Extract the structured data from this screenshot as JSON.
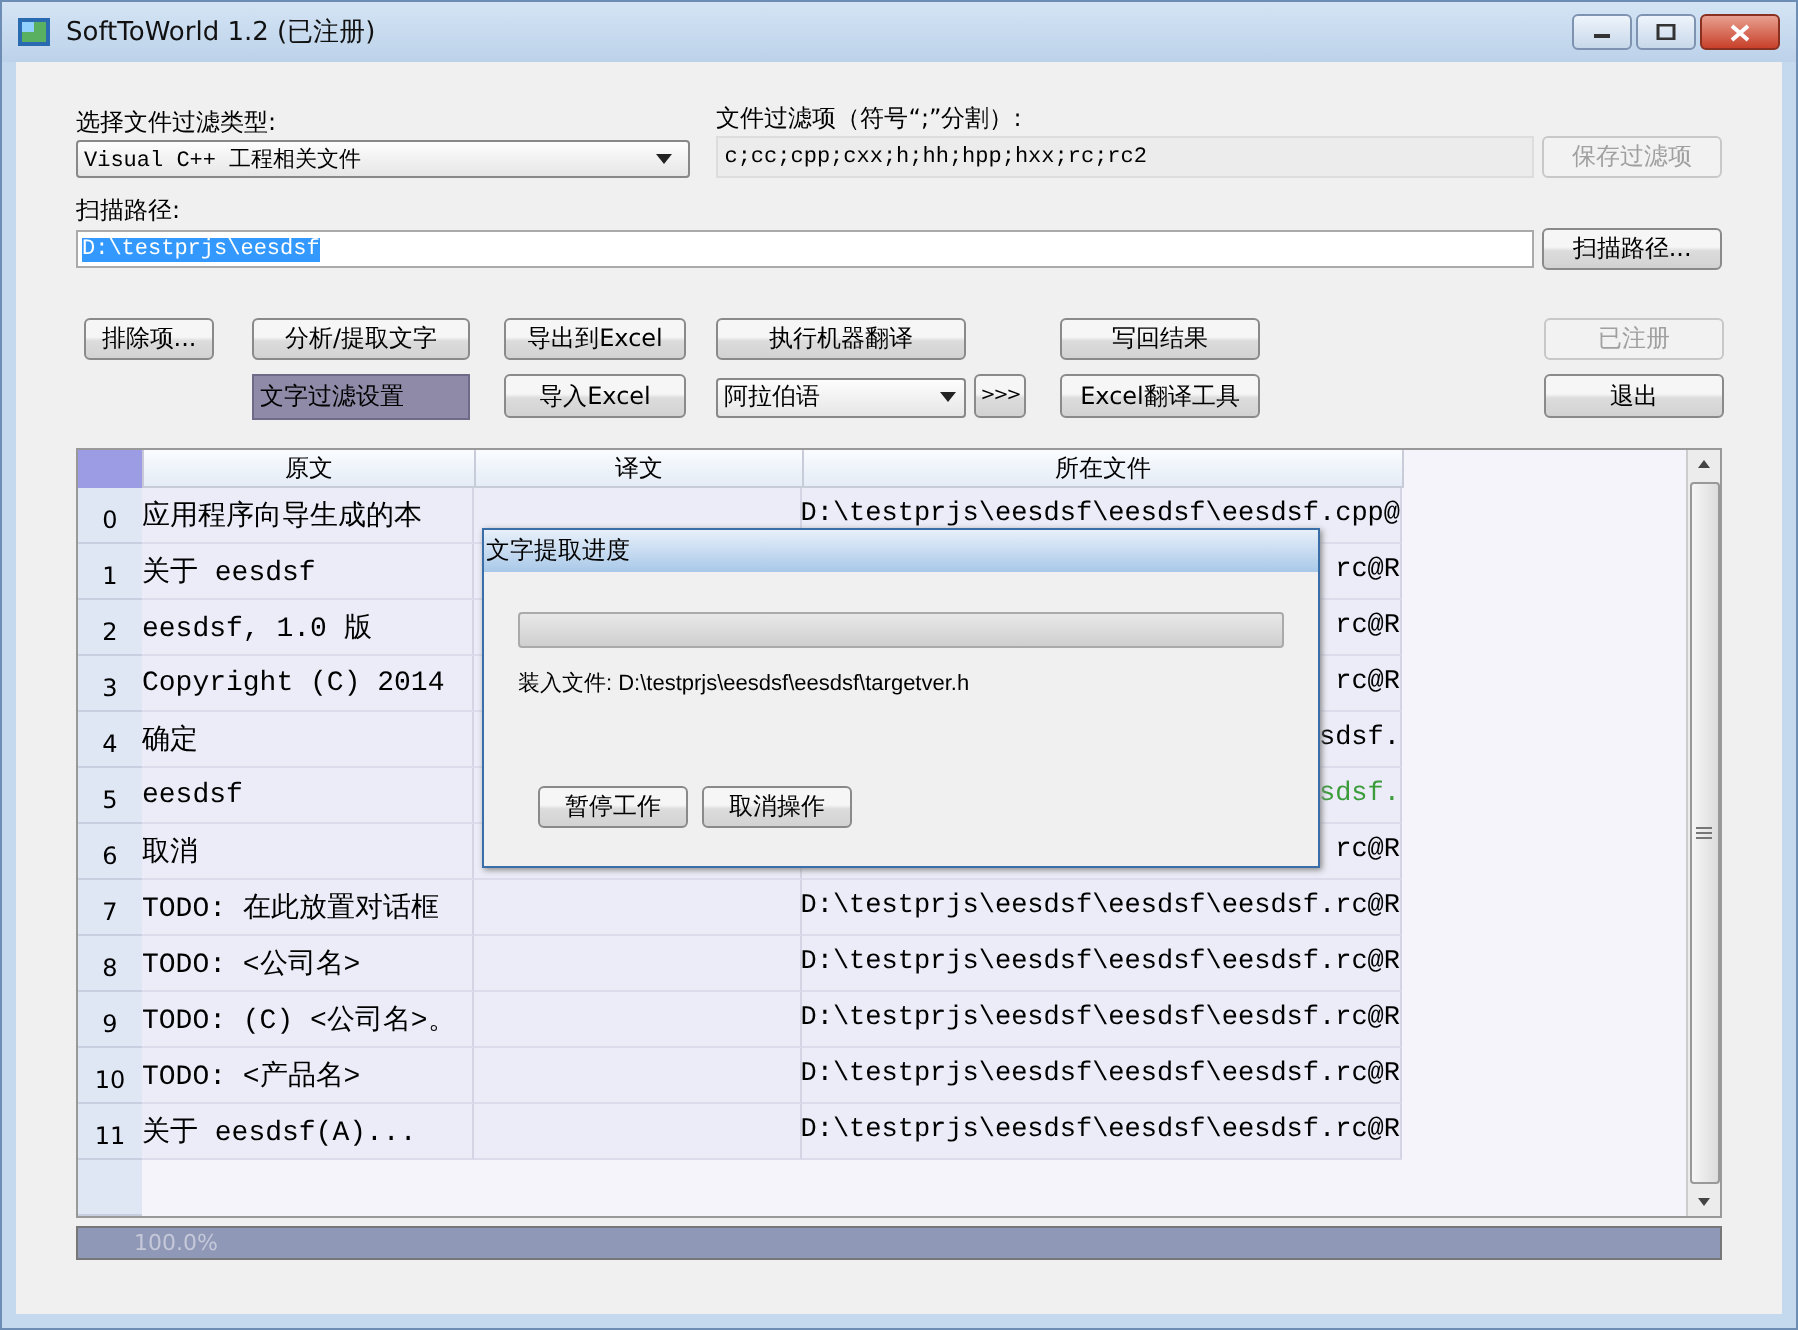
{
  "window": {
    "title": "SoftToWorld 1.2 (已注册)"
  },
  "filter_type": {
    "label": "选择文件过滤类型:",
    "value": "Visual C++ 工程相关文件"
  },
  "filter_items": {
    "label": "文件过滤项（符号“;”分割）:",
    "value": "c;cc;cpp;cxx;h;hh;hpp;hxx;rc;rc2"
  },
  "save_filter_button": {
    "label": "保存过滤项",
    "disabled": true
  },
  "scan_path": {
    "label": "扫描路径:",
    "value": "D:\\testprjs\\eesdsf",
    "selected": true
  },
  "scan_button": {
    "label": "扫描路径...",
    "disabled": false
  },
  "actions_row_1": [
    {
      "kind": "button",
      "label": "排除项...",
      "disabled": false
    },
    {
      "kind": "button",
      "label": "分析/提取文字",
      "disabled": false
    },
    {
      "kind": "button",
      "label": "导出到Excel",
      "disabled": false
    },
    {
      "kind": "button",
      "label": "执行机器翻译",
      "disabled": false
    },
    {
      "kind": "button",
      "label": "写回结果",
      "disabled": false
    },
    {
      "kind": "button",
      "label": "已注册",
      "disabled": true
    }
  ],
  "actions_row_2": [
    {
      "kind": "label",
      "label": "文字过滤设置"
    },
    {
      "kind": "button",
      "label": "导入Excel",
      "disabled": false
    },
    {
      "kind": "dropdown",
      "label": "阿拉伯语"
    },
    {
      "kind": "button",
      "label": ">>>",
      "disabled": false
    },
    {
      "kind": "button",
      "label": "Excel翻译工具",
      "disabled": false
    },
    {
      "kind": "button",
      "label": "退出",
      "disabled": false
    }
  ],
  "table": {
    "columns": [
      "原文",
      "译文",
      "所在文件"
    ],
    "rows": [
      {
        "index": "0",
        "source": "应用程序向导生成的本",
        "file": "D:\\testprjs\\eesdsf\\eesdsf\\eesdsf.cpp@",
        "color": "#000000"
      },
      {
        "index": "1",
        "source": "关于 eesdsf",
        "file": "rc@R",
        "color": "#000000"
      },
      {
        "index": "2",
        "source": "eesdsf, 1.0 版",
        "file": "rc@R",
        "color": "#000000"
      },
      {
        "index": "3",
        "source": "Copyright (C) 2014",
        "file": "rc@R",
        "color": "#000000"
      },
      {
        "index": "4",
        "source": "确定",
        "file": "sdsf.",
        "color": "#000000"
      },
      {
        "index": "5",
        "source": "eesdsf",
        "file": "sdsf.",
        "color": "#3c9c3c"
      },
      {
        "index": "6",
        "source": "取消",
        "file": "rc@R",
        "color": "#000000"
      },
      {
        "index": "7",
        "source": "TODO: 在此放置对话框",
        "file": "D:\\testprjs\\eesdsf\\eesdsf\\eesdsf.rc@R",
        "color": "#000000"
      },
      {
        "index": "8",
        "source": "TODO: <公司名>",
        "file": "D:\\testprjs\\eesdsf\\eesdsf\\eesdsf.rc@R",
        "color": "#000000"
      },
      {
        "index": "9",
        "source": "TODO: (C) <公司名>。",
        "file": "D:\\testprjs\\eesdsf\\eesdsf\\eesdsf.rc@R",
        "color": "#000000"
      },
      {
        "index": "10",
        "source": "TODO: <产品名>",
        "file": "D:\\testprjs\\eesdsf\\eesdsf\\eesdsf.rc@R",
        "color": "#000000"
      },
      {
        "index": "11",
        "source": "关于 eesdsf(A)...",
        "file": "D:\\testprjs\\eesdsf\\eesdsf\\eesdsf.rc@R",
        "color": "#000000"
      }
    ]
  },
  "progress": {
    "level": 1.0,
    "reading": "100.0%"
  },
  "dialog": {
    "title": "文字提取进度",
    "progress": {
      "level": 0
    },
    "status": "装入文件: D:\\testprjs\\eesdsf\\eesdsf\\targetver.h",
    "buttons": [
      "暂停工作",
      "取消操作"
    ]
  }
}
